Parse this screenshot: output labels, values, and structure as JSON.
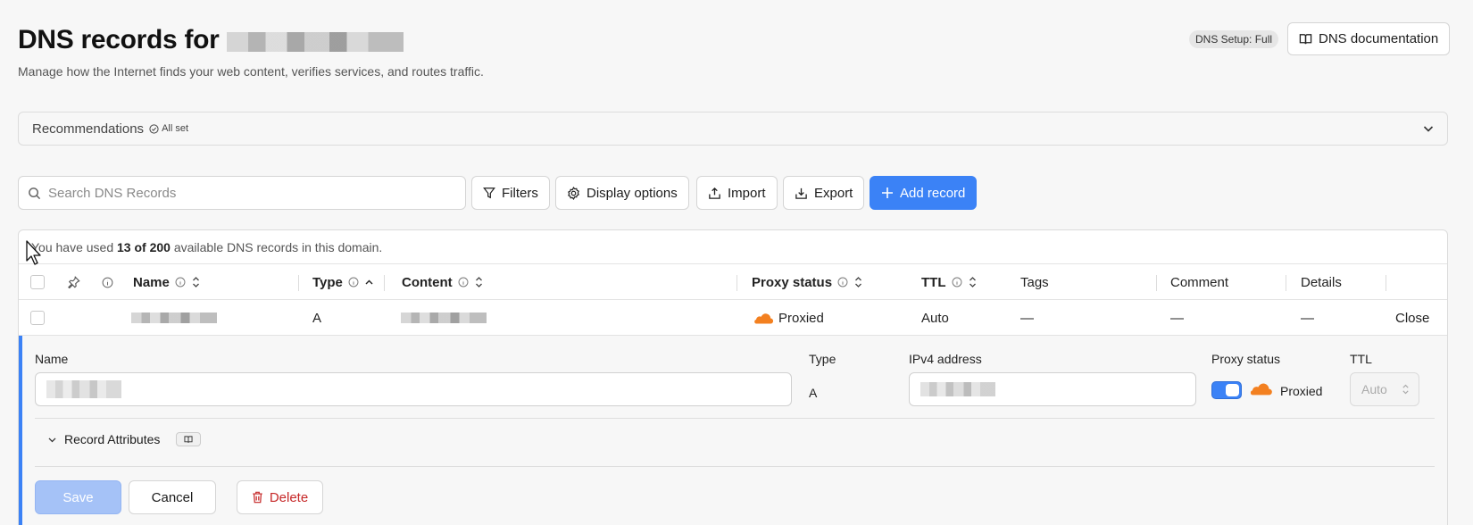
{
  "header": {
    "title_prefix": "DNS records for",
    "subtitle": "Manage how the Internet finds your web content, verifies services, and routes traffic.",
    "setup_badge": "DNS Setup: Full",
    "docs_button": "DNS documentation"
  },
  "recommendations": {
    "label": "Recommendations",
    "badge": "All set"
  },
  "toolbar": {
    "search_placeholder": "Search DNS Records",
    "filters": "Filters",
    "display_options": "Display options",
    "import": "Import",
    "export": "Export",
    "add_record": "Add record"
  },
  "usage": {
    "prefix": "You have used",
    "count": "13 of 200",
    "suffix": "available DNS records in this domain."
  },
  "table": {
    "columns": {
      "name": "Name",
      "type": "Type",
      "content": "Content",
      "proxy_status": "Proxy status",
      "ttl": "TTL",
      "tags": "Tags",
      "comment": "Comment",
      "details": "Details"
    },
    "row": {
      "type": "A",
      "proxy_status": "Proxied",
      "ttl": "Auto",
      "tags": "—",
      "comment": "—",
      "details": "—",
      "action": "Close"
    }
  },
  "edit_panel": {
    "name_label": "Name",
    "type_label": "Type",
    "type_value": "A",
    "ipv4_label": "IPv4 address",
    "proxy_label": "Proxy status",
    "proxy_value": "Proxied",
    "proxy_enabled": true,
    "ttl_label": "TTL",
    "ttl_value": "Auto",
    "record_attributes": "Record Attributes",
    "save": "Save",
    "cancel": "Cancel",
    "delete": "Delete"
  },
  "colors": {
    "accent": "#3b82f6",
    "cloud": "#f38020",
    "danger": "#c62828"
  }
}
